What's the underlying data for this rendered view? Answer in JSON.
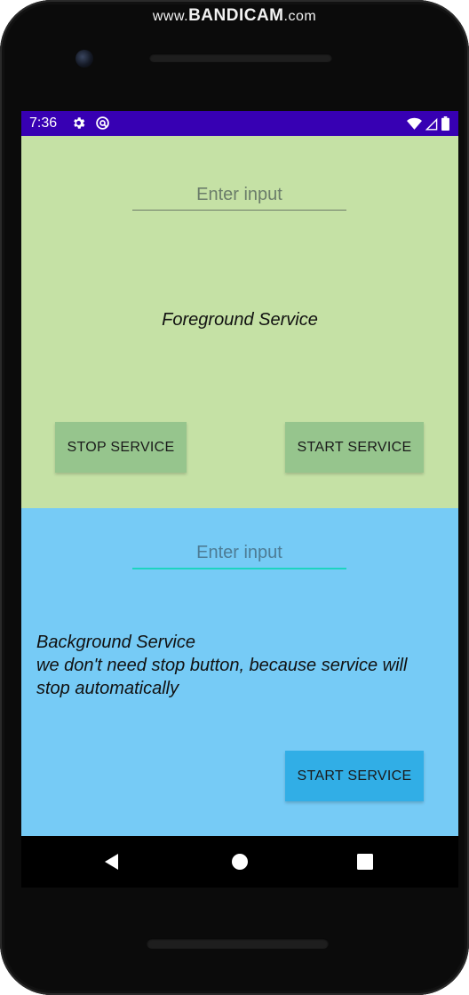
{
  "watermark": {
    "prefix": "www.",
    "brand": "BANDICAM",
    "suffix": ".com"
  },
  "status_bar": {
    "time": "7:36",
    "left_icons": [
      "settings-gear-icon",
      "sync-icon"
    ],
    "right_icons": [
      "wifi-icon",
      "signal-icon",
      "battery-icon"
    ],
    "background_color": "#3700b3"
  },
  "foreground_section": {
    "background_color": "#c5e1a5",
    "input": {
      "value": "",
      "placeholder": "Enter input"
    },
    "caption": "Foreground Service",
    "stop_button_label": "STOP SERVICE",
    "start_button_label": "START SERVICE",
    "button_color": "#96c58d"
  },
  "background_section": {
    "background_color": "#76cbf6",
    "input": {
      "value": "",
      "placeholder": "Enter input"
    },
    "caption_line1": "Background Service",
    "caption_line2": "we don't need stop button, because service will stop automatically",
    "start_button_label": "START SERVICE",
    "button_color": "#31aee6"
  },
  "nav_bar": {
    "buttons": [
      "back-triangle-icon",
      "home-circle-icon",
      "recents-square-icon"
    ]
  }
}
